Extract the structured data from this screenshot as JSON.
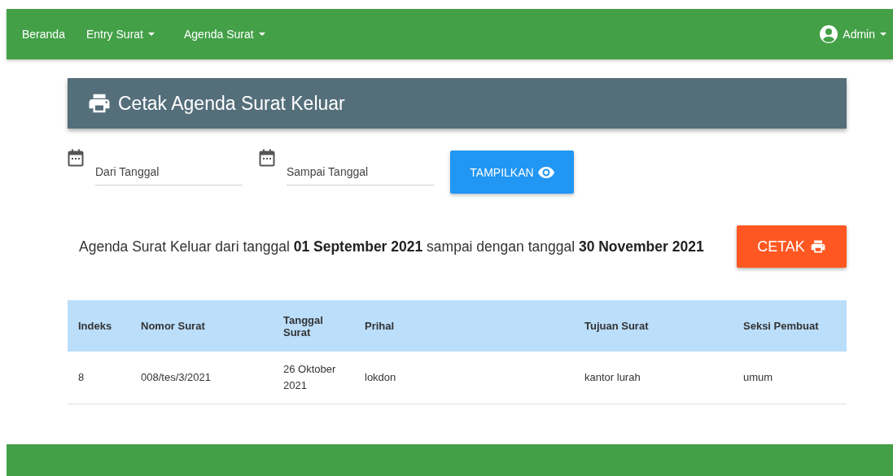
{
  "navbar": {
    "items": [
      {
        "label": "Beranda",
        "dropdown": false
      },
      {
        "label": "Entry Surat",
        "dropdown": true
      },
      {
        "label": "Agenda Surat",
        "dropdown": true
      }
    ],
    "user": {
      "label": "Admin",
      "dropdown": true
    }
  },
  "header": {
    "title": "Cetak Agenda Surat Keluar"
  },
  "filters": [
    {
      "placeholder": "Dari Tanggal"
    },
    {
      "placeholder": "Sampai Tanggal"
    }
  ],
  "show_button": "TAMPILKAN",
  "summary": "Agenda Surat Keluar dari tanggal **01 September 2021** sampai dengan tanggal **30 November 2021**",
  "print_button": "CETAK",
  "table": {
    "columns": [
      "Indeks",
      "Nomor Surat",
      "Tanggal Surat",
      "Prihal",
      "Tujuan Surat",
      "Seksi Pembuat"
    ],
    "rows": [
      [
        "8",
        "008/tes/3/2021",
        "26 Oktober 2021",
        "lokdon",
        "kantor lurah",
        "umum"
      ]
    ]
  }
}
